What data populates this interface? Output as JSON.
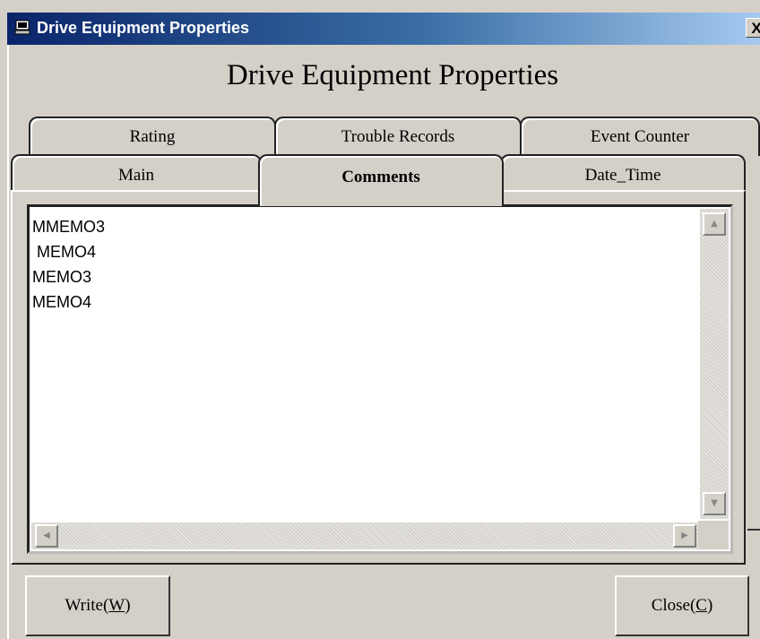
{
  "window": {
    "title": "Drive Equipment Properties",
    "close_glyph": "X",
    "icon": "computer-icon"
  },
  "heading": "Drive Equipment Properties",
  "tabs_row1": [
    {
      "label": "Rating"
    },
    {
      "label": "Trouble Records"
    },
    {
      "label": "Event Counter"
    }
  ],
  "tabs_row2": [
    {
      "label": "Main"
    },
    {
      "label": "Comments",
      "active": true
    },
    {
      "label": "Date_Time"
    }
  ],
  "memo": {
    "lines": [
      "MMEMO3",
      " MEMO4",
      "MEMO3",
      "MEMO4"
    ]
  },
  "scroll": {
    "up": "▲",
    "down": "▼",
    "left": "◀",
    "right": "▶"
  },
  "buttons": {
    "write": {
      "label": "Write(",
      "mnemonic": "W",
      "suffix": ")"
    },
    "close": {
      "label": "Close(",
      "mnemonic": "C",
      "suffix": ")"
    }
  },
  "colors": {
    "titlebar_start": "#0a246a",
    "titlebar_end": "#a6caf0",
    "face": "#d4d0c8"
  }
}
